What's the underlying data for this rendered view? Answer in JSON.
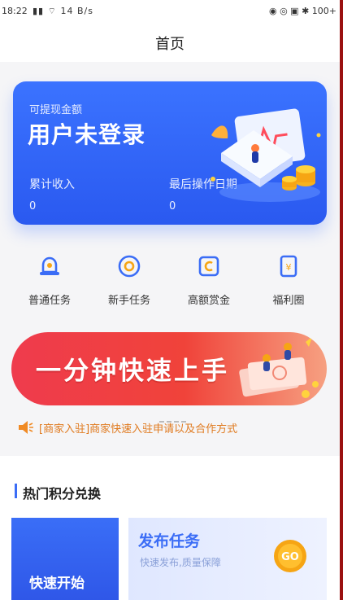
{
  "status_bar": {
    "time": "18:22",
    "signal": "ᴴⵍ",
    "network_speed": "14 B/s",
    "right_icons": "◉ ◎ ▣ ✱ 100+"
  },
  "header": {
    "title": "首页"
  },
  "balance_card": {
    "withdrawable_label": "可提现金额",
    "withdrawable_value": "用户未登录",
    "cumulative_label": "累计收入",
    "cumulative_value": "0",
    "last_op_label": "最后操作日期",
    "last_op_value": "0"
  },
  "quick_entries": [
    {
      "label": "普通任务",
      "icon": "bell-icon"
    },
    {
      "label": "新手任务",
      "icon": "target-icon"
    },
    {
      "label": "高额赏金",
      "icon": "coin-box-icon"
    },
    {
      "label": "福利圈",
      "icon": "gift-tag-icon"
    }
  ],
  "banner": {
    "text": "一分钟快速上手"
  },
  "notice": {
    "text": "[商家入驻]商家快速入驻申请以及合作方式"
  },
  "section": {
    "title": "热门积分兑换"
  },
  "tiles": {
    "left": "快速开始",
    "right_title": "发布任务",
    "right_subtitle": "快速发布,质量保障",
    "go_label": "GO"
  },
  "colors": {
    "primary": "#2f63f5",
    "banner_red": "#ef3b4d",
    "notice_orange": "#e07a1f"
  }
}
